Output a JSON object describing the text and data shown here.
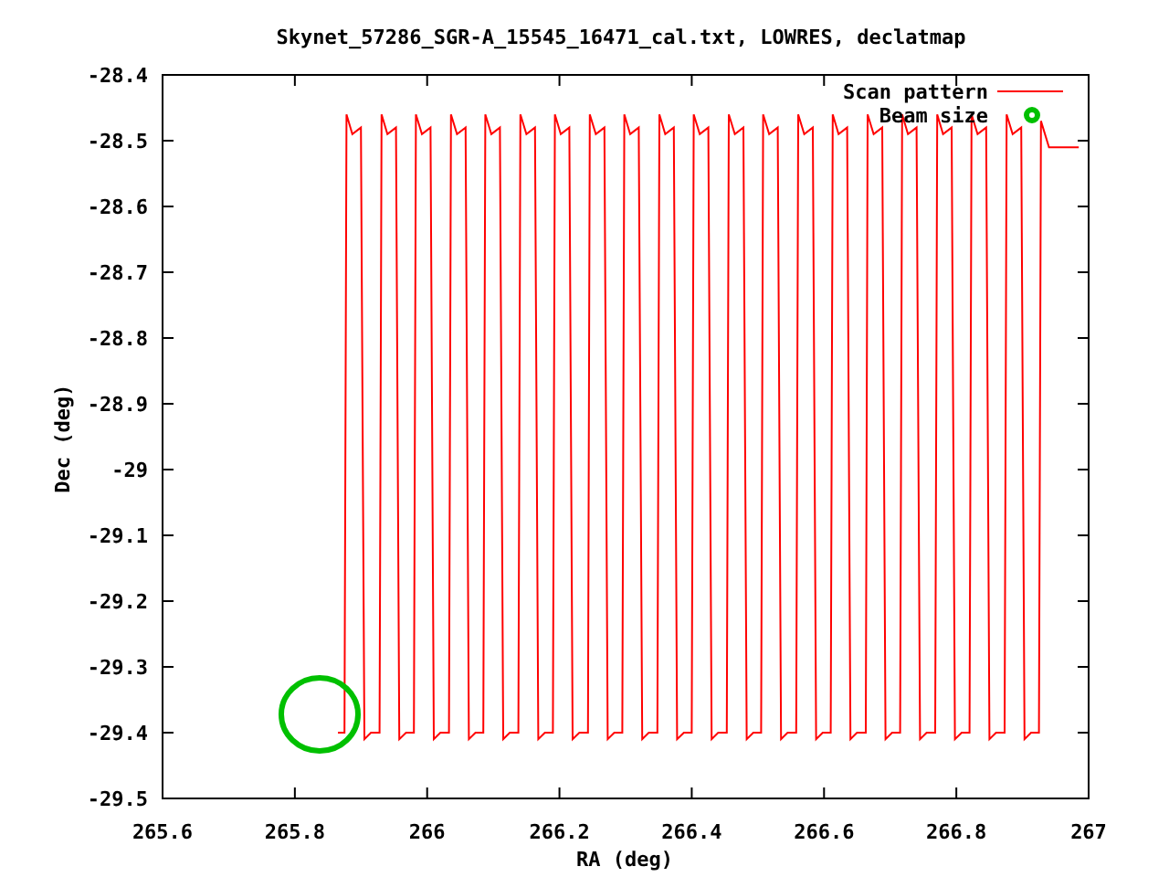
{
  "chart_data": {
    "type": "line",
    "title": "Skynet_57286_SGR-A_15545_16471_cal.txt, LOWRES, declatmap",
    "xlabel": "RA (deg)",
    "ylabel": "Dec (deg)",
    "xlim": [
      265.6,
      267
    ],
    "ylim": [
      -29.5,
      -28.4
    ],
    "xticks": [
      265.6,
      265.8,
      266,
      266.2,
      266.4,
      266.6,
      266.8,
      267
    ],
    "yticks": [
      -28.4,
      -28.5,
      -28.6,
      -28.7,
      -28.8,
      -28.9,
      -29,
      -29.1,
      -29.2,
      -29.3,
      -29.4,
      -29.5
    ],
    "series": [
      {
        "name": "Scan pattern",
        "color": "#ff0000",
        "x": [
          265.865,
          265.875,
          265.878,
          265.887,
          265.9,
          265.905,
          265.915,
          265.928,
          265.931,
          265.94,
          265.953,
          265.958,
          265.968,
          265.98,
          265.983,
          265.992,
          266.005,
          266.01,
          266.02,
          266.033,
          266.036,
          266.045,
          266.058,
          266.063,
          266.073,
          266.085,
          266.088,
          266.097,
          266.11,
          266.115,
          266.125,
          266.138,
          266.141,
          266.15,
          266.163,
          266.168,
          266.178,
          266.19,
          266.193,
          266.202,
          266.215,
          266.22,
          266.23,
          266.243,
          266.246,
          266.255,
          266.268,
          266.273,
          266.283,
          266.295,
          266.298,
          266.307,
          266.32,
          266.325,
          266.335,
          266.348,
          266.351,
          266.36,
          266.373,
          266.378,
          266.388,
          266.4,
          266.403,
          266.412,
          266.425,
          266.43,
          266.44,
          266.453,
          266.456,
          266.465,
          266.478,
          266.483,
          266.493,
          266.505,
          266.508,
          266.517,
          266.53,
          266.535,
          266.545,
          266.558,
          266.561,
          266.57,
          266.583,
          266.588,
          266.598,
          266.61,
          266.613,
          266.622,
          266.635,
          266.64,
          266.65,
          266.663,
          266.666,
          266.675,
          266.688,
          266.693,
          266.703,
          266.715,
          266.718,
          266.727,
          266.74,
          266.745,
          266.755,
          266.768,
          266.771,
          266.78,
          266.793,
          266.798,
          266.808,
          266.82,
          266.823,
          266.832,
          266.845,
          266.85,
          266.86,
          266.873,
          266.876,
          266.885,
          266.898,
          266.903,
          266.913,
          266.925,
          266.928,
          266.94,
          266.985
        ],
        "values": [
          -29.4,
          -29.4,
          -28.46,
          -28.49,
          -28.48,
          -29.41,
          -29.4,
          -29.4,
          -28.46,
          -28.49,
          -28.48,
          -29.41,
          -29.4,
          -29.4,
          -28.46,
          -28.49,
          -28.48,
          -29.41,
          -29.4,
          -29.4,
          -28.46,
          -28.49,
          -28.48,
          -29.41,
          -29.4,
          -29.4,
          -28.46,
          -28.49,
          -28.48,
          -29.41,
          -29.4,
          -29.4,
          -28.46,
          -28.49,
          -28.48,
          -29.41,
          -29.4,
          -29.4,
          -28.46,
          -28.49,
          -28.48,
          -29.41,
          -29.4,
          -29.4,
          -28.46,
          -28.49,
          -28.48,
          -29.41,
          -29.4,
          -29.4,
          -28.46,
          -28.49,
          -28.48,
          -29.41,
          -29.4,
          -29.4,
          -28.46,
          -28.49,
          -28.48,
          -29.41,
          -29.4,
          -29.4,
          -28.46,
          -28.49,
          -28.48,
          -29.41,
          -29.4,
          -29.4,
          -28.46,
          -28.49,
          -28.48,
          -29.41,
          -29.4,
          -29.4,
          -28.46,
          -28.49,
          -28.48,
          -29.41,
          -29.4,
          -29.4,
          -28.46,
          -28.49,
          -28.48,
          -29.41,
          -29.4,
          -29.4,
          -28.46,
          -28.49,
          -28.48,
          -29.41,
          -29.4,
          -29.4,
          -28.46,
          -28.49,
          -28.48,
          -29.41,
          -29.4,
          -29.4,
          -28.46,
          -28.49,
          -28.48,
          -29.41,
          -29.4,
          -29.4,
          -28.46,
          -28.49,
          -28.48,
          -29.41,
          -29.4,
          -29.4,
          -28.46,
          -28.49,
          -28.48,
          -29.41,
          -29.4,
          -29.4,
          -28.46,
          -28.49,
          -28.48,
          -29.41,
          -29.4,
          -29.4,
          -28.47,
          -28.51,
          -28.51
        ]
      },
      {
        "name": "Beam size",
        "color": "#00c000"
      }
    ]
  }
}
